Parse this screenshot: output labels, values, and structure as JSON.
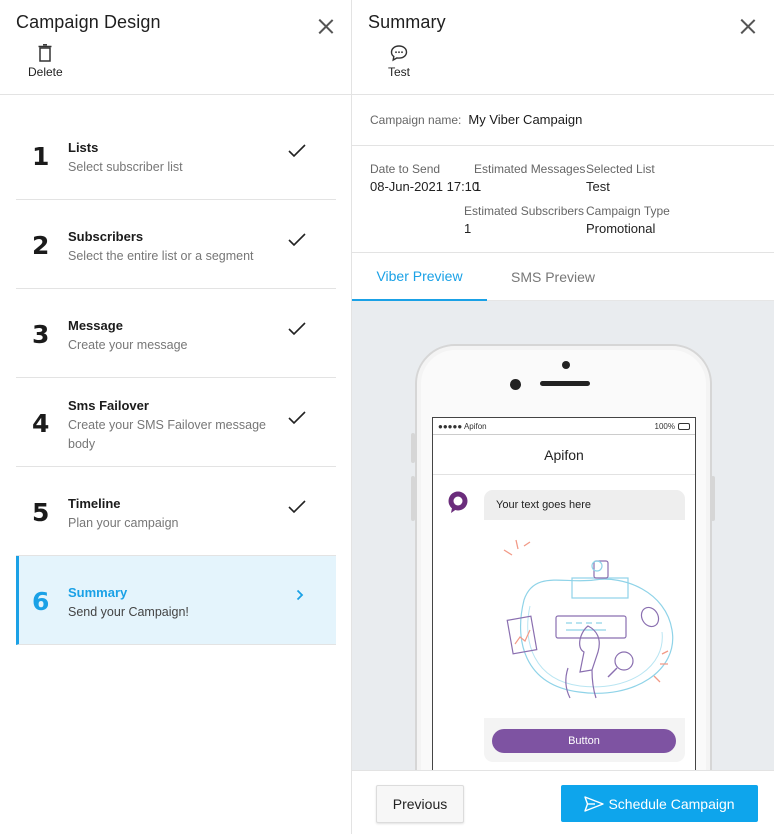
{
  "left_panel": {
    "title": "Campaign Design",
    "delete_label": "Delete",
    "steps": [
      {
        "number": "1",
        "title": "Lists",
        "subtitle": "Select subscriber list",
        "status": "done"
      },
      {
        "number": "2",
        "title": "Subscribers",
        "subtitle": "Select the entire list or a segment",
        "status": "done"
      },
      {
        "number": "3",
        "title": "Message",
        "subtitle": "Create your message",
        "status": "done"
      },
      {
        "number": "4",
        "title": "Sms Failover",
        "subtitle": "Create your SMS Failover message body",
        "status": "done"
      },
      {
        "number": "5",
        "title": "Timeline",
        "subtitle": "Plan your campaign",
        "status": "done"
      },
      {
        "number": "6",
        "title": "Summary",
        "subtitle": "Send your Campaign!",
        "status": "active"
      }
    ]
  },
  "right_panel": {
    "title": "Summary",
    "test_label": "Test",
    "campaign_name_label": "Campaign name:",
    "campaign_name": "My Viber Campaign",
    "date_to_send_label": "Date to Send",
    "date_to_send": "08-Jun-2021 17:10",
    "estimated_messages_label": "Estimated Messages",
    "estimated_messages": "1",
    "selected_list_label": "Selected List",
    "selected_list": "Test",
    "estimated_subscribers_label": "Estimated Subscribers",
    "estimated_subscribers": "1",
    "campaign_type_label": "Campaign Type",
    "campaign_type": "Promotional",
    "tabs": [
      {
        "label": "Viber Preview",
        "active": true
      },
      {
        "label": "SMS Preview",
        "active": false
      }
    ],
    "phone": {
      "carrier": "●●●●● Apifon",
      "battery": "100%",
      "chat_title": "Apifon",
      "message_text": "Your text goes here",
      "button_label": "Button"
    },
    "footer": {
      "previous_label": "Previous",
      "schedule_label": "Schedule Campaign"
    }
  },
  "colors": {
    "accent": "#1aa1e6",
    "active_bg": "#e4f4fc",
    "viber_purple": "#7e53a2",
    "schedule_button": "#0ea5ec",
    "preview_bg": "#e9ecef"
  }
}
